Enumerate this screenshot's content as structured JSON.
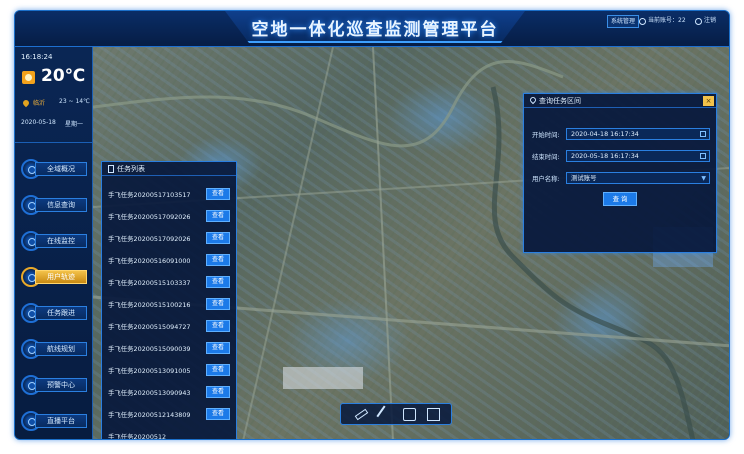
{
  "header": {
    "title": "空地一体化巡查监测管理平台",
    "system_button": "系统管理",
    "account_label": "当前账号：22",
    "logout_label": "注销"
  },
  "weather": {
    "time": "16:18:24",
    "temperature": "20℃",
    "city": "临沂",
    "range": "23 ~ 14℃",
    "date": "2020-05-18",
    "weekday": "星期一",
    "icon": "sun-icon"
  },
  "nav": {
    "items": [
      {
        "label": "全域概况",
        "active": false
      },
      {
        "label": "信息查询",
        "active": false
      },
      {
        "label": "在线监控",
        "active": false
      },
      {
        "label": "用户轨迹",
        "active": true
      },
      {
        "label": "任务跟进",
        "active": false
      },
      {
        "label": "航线规划",
        "active": false
      },
      {
        "label": "预警中心",
        "active": false
      },
      {
        "label": "直播平台",
        "active": false
      }
    ]
  },
  "tasks": {
    "title": "任务列表",
    "button_label": "查看",
    "items": [
      "手飞任务20200517103517",
      "手飞任务20200517092026",
      "手飞任务20200517092026",
      "手飞任务20200516091000",
      "手飞任务20200515103337",
      "手飞任务20200515100216",
      "手飞任务20200515094727",
      "手飞任务20200515090039",
      "手飞任务20200513091005",
      "手飞任务20200513090943",
      "手飞任务20200512143809",
      "手飞任务20200512"
    ]
  },
  "query": {
    "title": "查询任务区间",
    "start_label": "开始时间:",
    "start_value": "2020-04-18 16:17:34",
    "end_label": "结束时间:",
    "end_value": "2020-05-18 16:17:34",
    "user_label": "用户名称:",
    "user_value": "测试账号",
    "submit_label": "查 询",
    "close_icon": "close-icon"
  },
  "toolbar": {
    "tools": [
      "ruler-icon",
      "brush-icon",
      "print-icon",
      "image-icon"
    ]
  },
  "colors": {
    "accent": "#1c7ae8",
    "active_nav": "#f3c24a",
    "panel_bg": "#061a3a",
    "border": "#2a7fe0"
  }
}
